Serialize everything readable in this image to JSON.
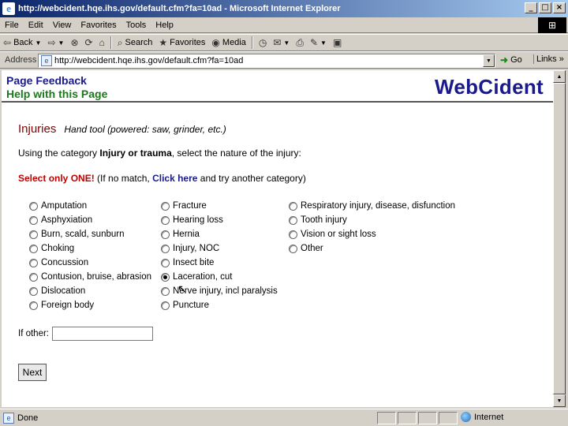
{
  "window": {
    "title": "http://webcident.hqe.ihs.gov/default.cfm?fa=10ad - Microsoft Internet Explorer",
    "logo_glyph": "e",
    "buttons": [
      "_",
      "□",
      "×"
    ]
  },
  "menu": [
    "File",
    "Edit",
    "View",
    "Favorites",
    "Tools",
    "Help"
  ],
  "toolbar": {
    "back": "Back",
    "search": "Search",
    "favorites": "Favorites",
    "media": "Media"
  },
  "address": {
    "label": "Address",
    "url": "http://webcident.hqe.ihs.gov/default.cfm?fa=10ad",
    "go": "Go",
    "links": "Links"
  },
  "page": {
    "feedback_link": "Page Feedback",
    "help_link": "Help with this Page",
    "brand": "WebCident",
    "heading": "Injuries",
    "subheading": "Hand tool (powered: saw, grinder, etc.)",
    "instr_prefix": "Using the category ",
    "instr_bold": "Injury or trauma",
    "instr_suffix": ", select the nature of the injury:",
    "warn_red": "Select only ONE!",
    "warn_mid": " (If no match, ",
    "warn_link": "Click here",
    "warn_suffix": " and try another category)",
    "options_col1": [
      "Amputation",
      "Asphyxiation",
      "Burn, scald, sunburn",
      "Choking",
      "Concussion",
      "Contusion, bruise, abrasion",
      "Dislocation",
      "Foreign body"
    ],
    "options_col2": [
      "Fracture",
      "Hearing loss",
      "Hernia",
      "Injury, NOC",
      "Insect bite",
      "Laceration, cut",
      "Nerve injury, incl paralysis",
      "Puncture"
    ],
    "options_col3": [
      "Respiratory injury, disease, disfunction",
      "Tooth injury",
      "Vision or sight loss",
      "Other"
    ],
    "selected": "Laceration, cut",
    "other_label": "If other:",
    "other_value": "",
    "next": "Next"
  },
  "status": {
    "text": "Done",
    "zone": "Internet"
  }
}
